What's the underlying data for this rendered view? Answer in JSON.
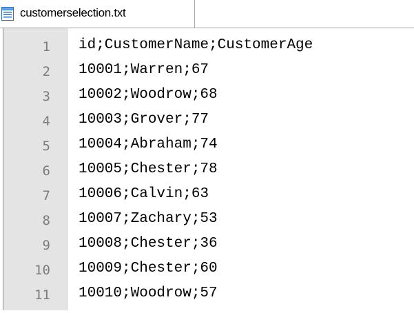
{
  "tab": {
    "filename": "customerselection.txt",
    "icon": "text-file-icon"
  },
  "editor": {
    "lines": [
      {
        "number": "1",
        "text": "id;CustomerName;CustomerAge"
      },
      {
        "number": "2",
        "text": "10001;Warren;67"
      },
      {
        "number": "3",
        "text": "10002;Woodrow;68"
      },
      {
        "number": "4",
        "text": "10003;Grover;77"
      },
      {
        "number": "5",
        "text": "10004;Abraham;74"
      },
      {
        "number": "6",
        "text": "10005;Chester;78"
      },
      {
        "number": "7",
        "text": "10006;Calvin;63"
      },
      {
        "number": "8",
        "text": "10007;Zachary;53"
      },
      {
        "number": "9",
        "text": "10008;Chester;36"
      },
      {
        "number": "10",
        "text": "10009;Chester;60"
      },
      {
        "number": "11",
        "text": "10010;Woodrow;57"
      }
    ]
  },
  "colors": {
    "gutter_background": "#e4e4e4",
    "line_number": "#7c7c7c",
    "text": "#000000",
    "icon_blue": "#2a6fc0"
  }
}
